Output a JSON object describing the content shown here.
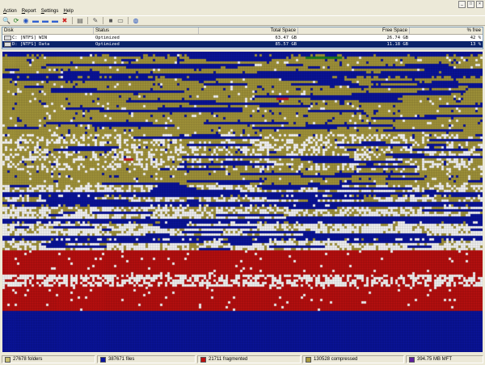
{
  "window": {
    "minimize": "_",
    "maximize": "□",
    "close": "×"
  },
  "menu": [
    {
      "key": "A",
      "rest": "ction"
    },
    {
      "key": "R",
      "rest": "eport"
    },
    {
      "key": "S",
      "rest": "ettings"
    },
    {
      "key": "H",
      "rest": "elp"
    }
  ],
  "toolbar": [
    {
      "name": "analyze-icon",
      "glyph": "🔍"
    },
    {
      "name": "refresh-icon",
      "glyph": "⟳"
    },
    {
      "name": "defrag-icon",
      "glyph": "◉"
    },
    {
      "name": "quick-optimize-icon",
      "glyph": "▬"
    },
    {
      "name": "full-optimize-icon",
      "glyph": "▬"
    },
    {
      "name": "mft-optimize-icon",
      "glyph": "▬"
    },
    {
      "name": "stop-icon",
      "glyph": "✖"
    },
    {
      "sep": true
    },
    {
      "name": "report-icon",
      "glyph": "▤"
    },
    {
      "sep": true
    },
    {
      "name": "settings-icon",
      "glyph": "✎"
    },
    {
      "sep": true
    },
    {
      "name": "terminal-icon",
      "glyph": "■"
    },
    {
      "name": "log-icon",
      "glyph": "▭"
    },
    {
      "sep": true
    },
    {
      "name": "help-icon",
      "glyph": "◍"
    }
  ],
  "columns": {
    "disk": "Disk",
    "status": "Status",
    "total": "Total Space",
    "free": "Free Space",
    "pct": "% free"
  },
  "disks": [
    {
      "disk": "C: [NTFS]  WIN",
      "status": "Optimized",
      "total": "63.47 GB",
      "free": "26.74 GB",
      "pct": "42 %",
      "selected": false
    },
    {
      "disk": "D: [NTFS]  Data",
      "status": "Optimized",
      "total": "85.57 GB",
      "free": "11.18 GB",
      "pct": "13 %",
      "selected": true
    }
  ],
  "colors": {
    "folders": "#a89a3c",
    "files": "#0a14a0",
    "fragmented": "#c01010",
    "compressed": "#c8c070",
    "mft": "#6020a0",
    "free": "#ffffff",
    "grid": "#d0d0d0",
    "unfragmented_green": "#208020",
    "small_red": "#d02020"
  },
  "legend": [
    {
      "name": "legend-folders",
      "text": "27678 folders",
      "color": "#c8c070",
      "width": 116
    },
    {
      "name": "legend-files",
      "text": "387671 files",
      "color": "#0a14a0",
      "width": 122
    },
    {
      "name": "legend-fragmented",
      "text": "21711 fragmented",
      "color": "#c01010",
      "width": 128
    },
    {
      "name": "legend-compressed",
      "text": "130528 compressed",
      "color": "#a89a3c",
      "width": 126
    },
    {
      "name": "legend-mft",
      "text": "394.75 MB MFT",
      "color": "#6020a0",
      "width": 96
    }
  ]
}
